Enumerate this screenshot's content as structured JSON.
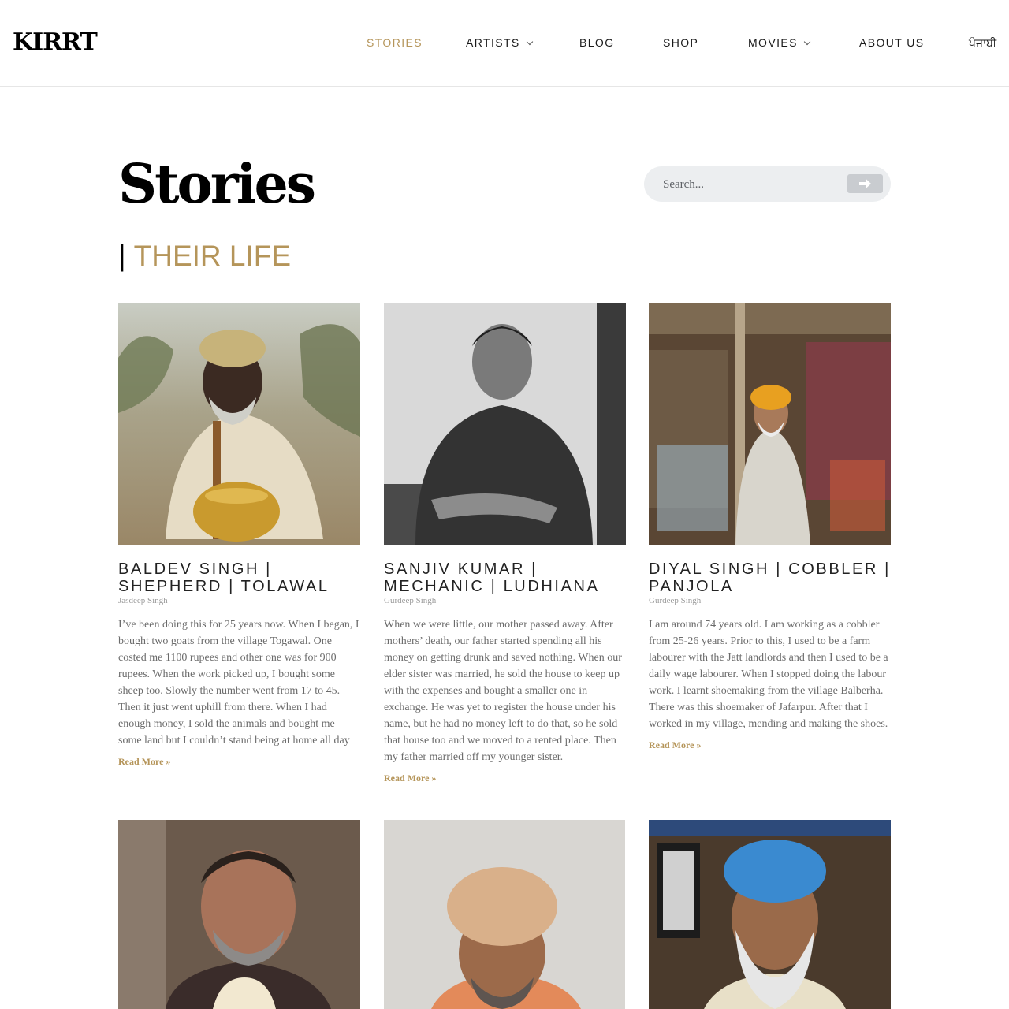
{
  "header": {
    "logo": "KIRRT",
    "nav": [
      {
        "label": "STORIES",
        "active": true,
        "dropdown": false
      },
      {
        "label": "ARTISTS",
        "active": false,
        "dropdown": true
      },
      {
        "label": "BLOG",
        "active": false,
        "dropdown": false
      },
      {
        "label": "SHOP",
        "active": false,
        "dropdown": false
      },
      {
        "label": "MOVIES",
        "active": false,
        "dropdown": true
      },
      {
        "label": "ABOUT US",
        "active": false,
        "dropdown": false
      },
      {
        "label": "ਪੰਜਾਬੀ",
        "active": false,
        "dropdown": false
      }
    ]
  },
  "page": {
    "title": "Stories",
    "subtitle_bar": "|",
    "subtitle": "THEIR LIFE"
  },
  "search": {
    "placeholder": "Search..."
  },
  "cards": [
    {
      "title": "BALDEV SINGH | SHEPHERD | TOLAWAL",
      "author": "Jasdeep Singh",
      "excerpt": "I’ve been doing this for 25 years now. When I began, I bought two goats from the village Togawal. One costed me 1100 rupees and other one was for 900 rupees. When the work picked up, I bought some sheep too. Slowly the number went from 17 to 45. Then it just went uphill from there. When I had enough money, I sold the animals and bought me some land but I couldn’t stand being at home all day",
      "more": "Read More »"
    },
    {
      "title": "SANJIV KUMAR | MECHANIC | LUDHIANA",
      "author": "Gurdeep Singh",
      "excerpt": "When we were little, our mother passed away. After mothers’ death, our father started spending all his money on getting drunk and saved nothing. When our elder sister was married, he sold the house to keep up with the expenses and bought a smaller one in exchange. He was yet to register the house under his name, but he had no money left to do that, so he sold that house too and we moved to a rented place. Then my father married off my younger sister.",
      "more": "Read More »"
    },
    {
      "title": "DIYAL SINGH | COBBLER | PANJOLA",
      "author": "Gurdeep Singh",
      "excerpt": "I am around 74 years old. I am working as a cobbler from 25-26 years. Prior to this, I used to be a farm labourer with the Jatt landlords and then I used to be a daily wage labourer. When I stopped doing the labour work. I learnt shoemaking from the village Balberha. There was this shoemaker of Jafarpur. After that I worked in my village, mending and making the shoes.",
      "more": "Read More »"
    }
  ],
  "colors": {
    "accent": "#b5955a",
    "text": "#222222",
    "search_bg": "#eceef0"
  }
}
